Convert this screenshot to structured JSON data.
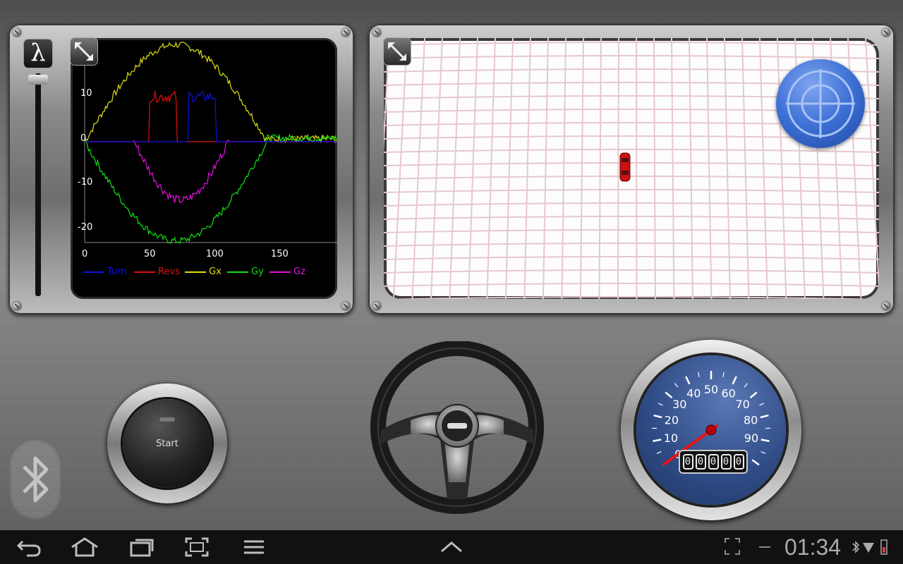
{
  "graph": {
    "y_ticks": [
      "10",
      "0",
      "-10",
      "-20"
    ],
    "x_ticks": [
      "0",
      "50",
      "100",
      "150"
    ],
    "legend": [
      {
        "label": "Turn",
        "color": "#1010e0"
      },
      {
        "label": "Revs",
        "color": "#e01010"
      },
      {
        "label": "Gx",
        "color": "#e0e010"
      },
      {
        "label": "Gy",
        "color": "#10e010"
      },
      {
        "label": "Gz",
        "color": "#e010e0"
      }
    ]
  },
  "slider": {
    "level": 0.02
  },
  "start_button": {
    "label": "Start"
  },
  "speedometer": {
    "ticks": [
      "0",
      "10",
      "20",
      "30",
      "40",
      "50",
      "60",
      "70",
      "80",
      "90"
    ],
    "odometer": [
      "0",
      "0",
      "0",
      "0",
      "0"
    ],
    "value": 0
  },
  "statusbar": {
    "time": "01:34"
  },
  "icons": {
    "lambda": "lambda-icon",
    "expand": "expand-icon",
    "compass": "compass-icon",
    "car": "car-icon",
    "bluetooth": "bluetooth-icon",
    "back": "back-icon",
    "home": "home-icon",
    "recent": "recent-apps-icon",
    "screenshot": "screenshot-icon",
    "menu": "menu-icon",
    "chevron": "chevron-up-icon"
  },
  "colors": {
    "grid_line": "#e6c8cc",
    "car": "#cc1111",
    "compass": "#3c6fd4",
    "needle": "#ee1111"
  }
}
